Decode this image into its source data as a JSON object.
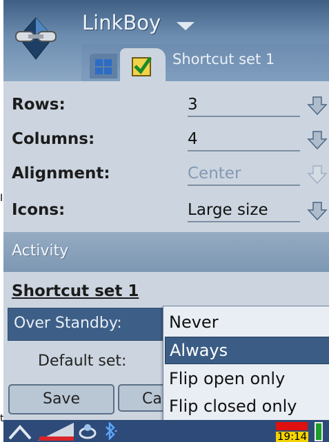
{
  "header": {
    "title": "LinkBoy",
    "tab_caption": "Shortcut set 1"
  },
  "settings": [
    {
      "label": "Rows:",
      "value": "3"
    },
    {
      "label": "Columns:",
      "value": "4"
    },
    {
      "label": "Alignment:",
      "value": "Center",
      "disabled": true
    },
    {
      "label": "Icons:",
      "value": "Large size"
    }
  ],
  "activity": {
    "section_label": "Activity",
    "set_heading": "Shortcut set 1",
    "standby_label": "Over Standby:",
    "default_label": "Default set:"
  },
  "buttons": {
    "save": "Save",
    "cancel_partial": "Ca"
  },
  "dropdown": {
    "options": [
      "Never",
      "Always",
      "Flip open only",
      "Flip closed only"
    ],
    "selected": "Always"
  },
  "status_bar": {
    "time": "19:14"
  },
  "stray_left": {
    "mid": "I",
    "bottom": "t"
  },
  "colors": {
    "header_dark": "#3f5f84",
    "selection": "#3b5d85",
    "background": "#ccd5df",
    "battery_red": "#e01010"
  },
  "icons": [
    "link-chain-logo",
    "dropdown-triangle-icon",
    "grid-tab-icon",
    "checklist-tab-icon",
    "down-arrow-icon",
    "up-caret-icon",
    "signal-strength-icon",
    "data-connection-icon",
    "bluetooth-icon",
    "battery-icon"
  ]
}
